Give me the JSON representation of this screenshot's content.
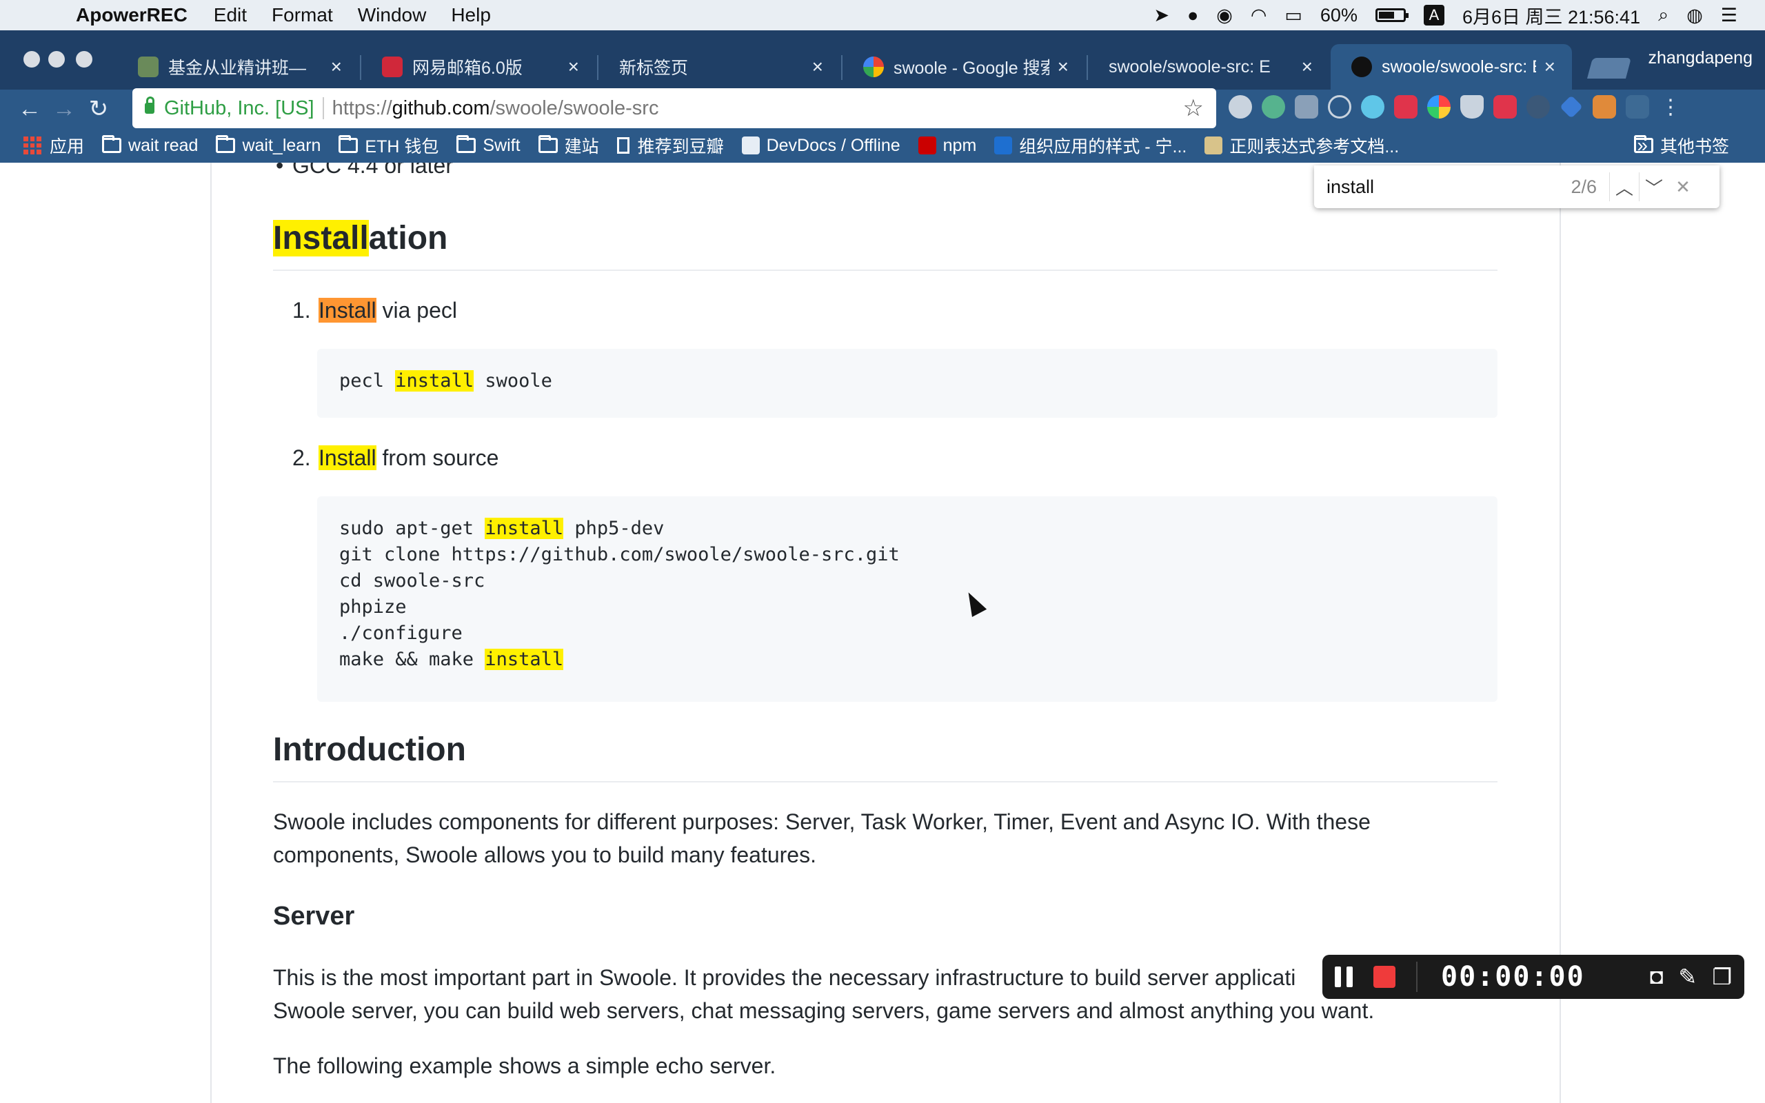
{
  "menubar": {
    "app_name": "ApowerREC",
    "items": [
      "Edit",
      "Format",
      "Window",
      "Help"
    ],
    "battery": "60%",
    "input_source": "A",
    "datetime": "6月6日 周三  21:56:41"
  },
  "tabs": [
    {
      "title": "基金从业精讲班—",
      "close": "×"
    },
    {
      "title": "网易邮箱6.0版",
      "close": "×"
    },
    {
      "title": "新标签页",
      "close": "×"
    },
    {
      "title": "swoole - Google 搜索",
      "close": "×"
    },
    {
      "title": "swoole/swoole-src: E",
      "close": "×"
    },
    {
      "title": "swoole/swoole-src: E",
      "close": "×"
    }
  ],
  "profile_name": "zhangdapeng",
  "omnibox": {
    "cert": "GitHub, Inc. [US]",
    "scheme": "https://",
    "host": "github.com",
    "path": "/swoole/swoole-src"
  },
  "bookmarks": [
    {
      "label": "应用"
    },
    {
      "label": "wait read"
    },
    {
      "label": "wait_learn"
    },
    {
      "label": "ETH 钱包"
    },
    {
      "label": "Swift"
    },
    {
      "label": "建站"
    },
    {
      "label": "推荐到豆瓣"
    },
    {
      "label": "DevDocs / Offline"
    },
    {
      "label": "npm"
    },
    {
      "label": "组织应用的样式 - 宁..."
    },
    {
      "label": "正则表达式参考文档..."
    }
  ],
  "bookmarks_more": "»",
  "bookmarks_other": "其他书签",
  "find": {
    "query": "install",
    "count": "2/6"
  },
  "content": {
    "prev_bullet": "GCC 4.4 or later",
    "installation": {
      "heading_match": "Install",
      "heading_rest": "ation",
      "step1": {
        "num": "1.",
        "match": "Install",
        "rest": " via pecl"
      },
      "code1": {
        "pre": "pecl ",
        "match": "install",
        "post": " swoole"
      },
      "step2": {
        "num": "2.",
        "match": "Install",
        "rest": " from source"
      },
      "code2": {
        "l1_pre": "sudo apt-get ",
        "l1_match": "install",
        "l1_post": " php5-dev",
        "l2": "git clone https://github.com/swoole/swoole-src.git",
        "l3": "cd swoole-src",
        "l4": "phpize",
        "l5": "./configure",
        "l6_pre": "make && make ",
        "l6_match": "install"
      }
    },
    "introduction": {
      "heading": "Introduction",
      "text": "Swoole includes components for different purposes: Server, Task Worker, Timer, Event and Async IO. With these components, Swoole allows you to build many features."
    },
    "server": {
      "heading": "Server",
      "text1": "This is the most important part in Swoole. It provides the necessary infrastructure to build server applicati",
      "text1_cont": "Swoole server, you can build web servers, chat messaging servers, game servers and almost anything you want.",
      "text2": "The following example shows a simple echo server."
    }
  },
  "recorder": {
    "timer": "00:00:00"
  }
}
